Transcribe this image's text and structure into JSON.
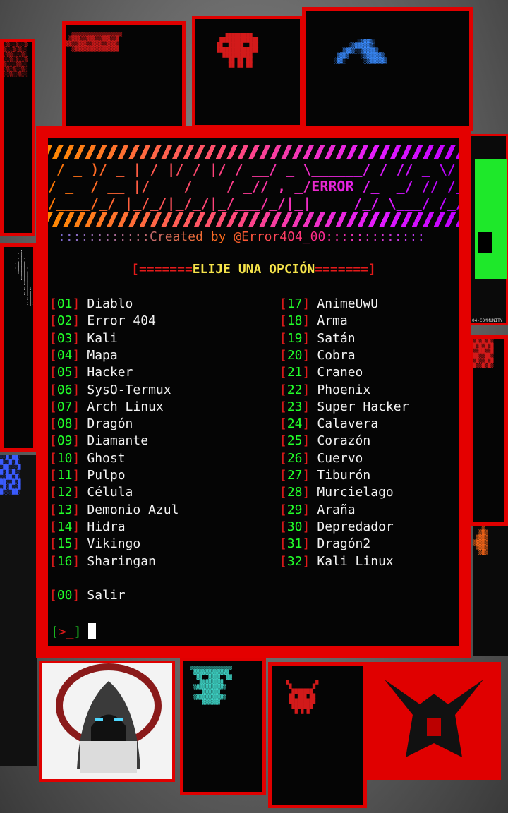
{
  "terminal": {
    "banner_rows": [
      " / _ )/ _ | / |/ / |/ / __/ _ \\______/ / // _ \\/ / /",
      "/ _  / __ |/    /    / _// , _/ERROR /_  _/ // /_  _/",
      "/____/_/ |_/_/|_/_/|_/___/_/|_|     /_/ \\___/ /_/"
    ],
    "error_tag": "ERROR",
    "credit": "::::::::::::Created by @Error404_00:::::::::::::",
    "menu_header": {
      "left_bracket": "[",
      "left_eq": "=======",
      "title": "ELIJE UNA OPCIÓN",
      "right_eq": "=======",
      "right_bracket": "]"
    },
    "options_left": [
      {
        "num": "01",
        "label": "Diablo"
      },
      {
        "num": "02",
        "label": "Error 404"
      },
      {
        "num": "03",
        "label": "Kali"
      },
      {
        "num": "04",
        "label": "Mapa"
      },
      {
        "num": "05",
        "label": "Hacker"
      },
      {
        "num": "06",
        "label": "SysO-Termux"
      },
      {
        "num": "07",
        "label": "Arch Linux"
      },
      {
        "num": "08",
        "label": "Dragón"
      },
      {
        "num": "09",
        "label": "Diamante"
      },
      {
        "num": "10",
        "label": "Ghost"
      },
      {
        "num": "11",
        "label": "Pulpo"
      },
      {
        "num": "12",
        "label": "Célula"
      },
      {
        "num": "13",
        "label": "Demonio Azul"
      },
      {
        "num": "14",
        "label": "Hidra"
      },
      {
        "num": "15",
        "label": "Vikingo"
      },
      {
        "num": "16",
        "label": "Sharingan"
      }
    ],
    "options_right": [
      {
        "num": "17",
        "label": "AnimeUwU"
      },
      {
        "num": "18",
        "label": "Arma"
      },
      {
        "num": "19",
        "label": "Satán"
      },
      {
        "num": "20",
        "label": "Cobra"
      },
      {
        "num": "21",
        "label": "Craneo"
      },
      {
        "num": "22",
        "label": "Phoenix"
      },
      {
        "num": "23",
        "label": "Super Hacker"
      },
      {
        "num": "24",
        "label": "Calavera"
      },
      {
        "num": "25",
        "label": "Corazón"
      },
      {
        "num": "26",
        "label": "Cuervo"
      },
      {
        "num": "27",
        "label": "Tiburón"
      },
      {
        "num": "28",
        "label": "Murcielago"
      },
      {
        "num": "29",
        "label": "Araña"
      },
      {
        "num": "30",
        "label": "Depredador"
      },
      {
        "num": "31",
        "label": "Dragón2"
      },
      {
        "num": "32",
        "label": "Kali Linux"
      }
    ],
    "exit_option": {
      "num": "00",
      "label": "Salir"
    },
    "prompt": {
      "open": "[",
      "arrow": ">_",
      "close": "]"
    }
  },
  "phone": {
    "footer": "04-COMMUNITY"
  },
  "colors": {
    "frame": "#e40000",
    "number": "#22ff2a",
    "bracket": "#e51a1a",
    "header_text": "#f5e34a"
  }
}
